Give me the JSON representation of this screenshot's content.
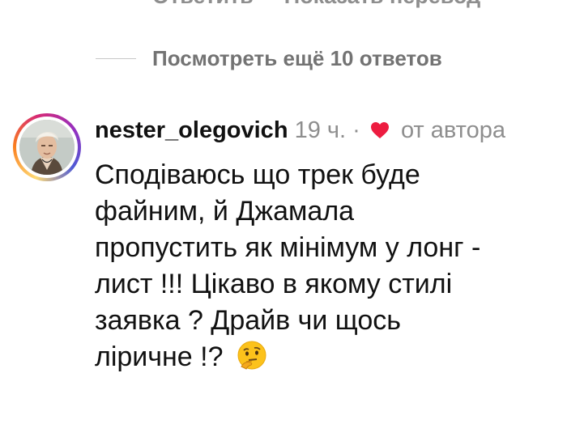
{
  "top_actions": {
    "reply_label": "Ответить",
    "translate_label": "Показать перевод"
  },
  "more_replies": {
    "label": "Посмотреть ещё 10 ответов"
  },
  "comment": {
    "username": "nester_olegovich",
    "time": "19 ч.",
    "separator": "·",
    "liked_by_author_label": "от автора",
    "text": "Сподіваюсь що трек буде\nфайним, й Джамала\nпропустить як мінімум у лонг -\nлист !!! Цікаво в якому стилі\nзаявка ? Драйв чи щось\nліричне !?",
    "emoji_icon": "thinking-face-icon",
    "heart_color": "#ed1c40"
  }
}
